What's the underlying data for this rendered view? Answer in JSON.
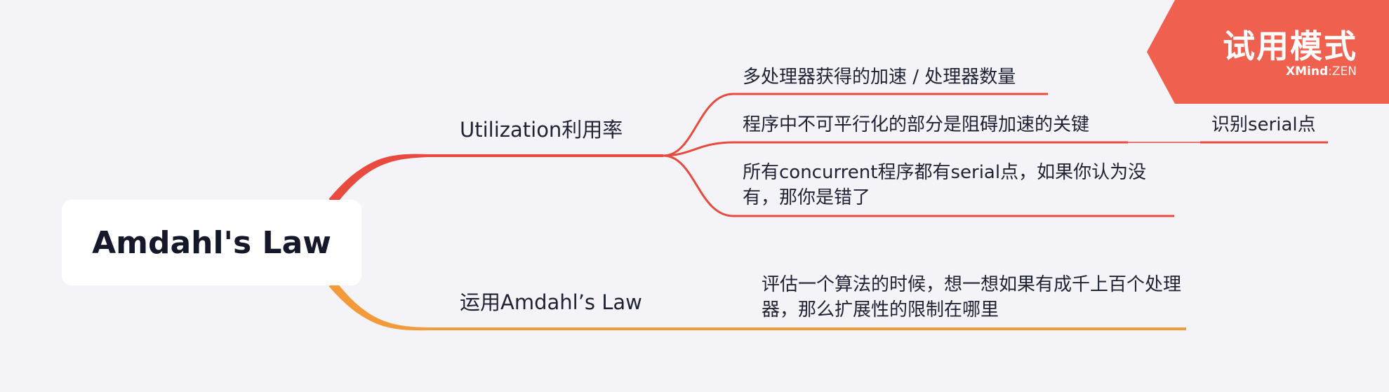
{
  "root": {
    "label": "Amdahl's Law"
  },
  "branches": [
    {
      "label": "Utilization利用率",
      "color": "#e84a3f",
      "children": [
        {
          "label": "多处理器获得的加速 / 处理器数量"
        },
        {
          "label": "程序中不可平行化的部分是阻碍加速的关键",
          "children": [
            {
              "label": "识别serial点"
            }
          ]
        },
        {
          "label": "所有concurrent程序都有serial点，如果你认为没有，那你是错了"
        }
      ]
    },
    {
      "label": "运用Amdahl’s Law",
      "color": "#f39a3a",
      "children": [
        {
          "label": "评估一个算法的时候，想一想如果有成千上百个处理器，那么扩展性的限制在哪里"
        }
      ]
    }
  ],
  "watermark": {
    "title": "试用模式",
    "brand": "XMind",
    "separator": ":",
    "edition": "ZEN",
    "color": "#f0604e"
  }
}
